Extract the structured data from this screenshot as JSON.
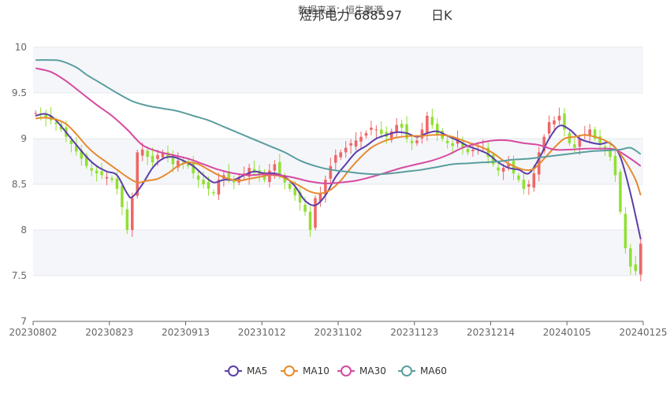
{
  "chart_data": {
    "type": "candlestick",
    "title": "煜邦电力 688597",
    "title_suffix": "日K",
    "subtitle": "数据来源：恒生聚源",
    "xlabel": "",
    "ylabel": "",
    "ylim": [
      7,
      10
    ],
    "yticks": [
      7,
      7.5,
      8,
      8.5,
      9,
      9.5,
      10
    ],
    "ytick_labels": [
      "7",
      "7.5",
      "8",
      "8.5",
      "9",
      "9.5",
      "10"
    ],
    "xtick_labels": [
      "20230802",
      "20230823",
      "20230913",
      "20231012",
      "20231102",
      "20231123",
      "20231214",
      "20240105",
      "20240125"
    ],
    "n_days": 120,
    "up_color": "#ee6666",
    "down_color": "#91e033",
    "grid_band_color": "#f5f6fa",
    "close": [
      9.28,
      9.26,
      9.22,
      9.2,
      9.16,
      9.1,
      9.02,
      8.94,
      8.86,
      8.78,
      8.7,
      8.65,
      8.62,
      8.6,
      8.58,
      8.55,
      8.45,
      8.25,
      8.0,
      8.35,
      8.85,
      8.88,
      8.8,
      8.74,
      8.82,
      8.85,
      8.8,
      8.72,
      8.76,
      8.74,
      8.7,
      8.62,
      8.55,
      8.5,
      8.45,
      8.4,
      8.55,
      8.6,
      8.56,
      8.52,
      8.58,
      8.62,
      8.68,
      8.64,
      8.6,
      8.55,
      8.65,
      8.72,
      8.6,
      8.52,
      8.45,
      8.38,
      8.3,
      8.2,
      8.0,
      8.35,
      8.4,
      8.55,
      8.7,
      8.82,
      8.85,
      8.9,
      8.95,
      8.98,
      9.02,
      9.06,
      9.12,
      9.1,
      9.05,
      9.02,
      9.08,
      9.15,
      9.12,
      9.0,
      8.95,
      8.98,
      9.1,
      9.25,
      9.15,
      9.05,
      9.0,
      8.95,
      8.92,
      9.0,
      8.9,
      8.85,
      8.88,
      8.92,
      8.9,
      8.8,
      8.72,
      8.65,
      8.68,
      8.72,
      8.62,
      8.55,
      8.45,
      8.5,
      8.62,
      8.85,
      9.02,
      9.18,
      9.2,
      9.25,
      9.1,
      8.95,
      8.9,
      9.0,
      9.05,
      9.1,
      9.0,
      8.95,
      8.9,
      8.8,
      8.6,
      8.2,
      7.8,
      7.6,
      7.55,
      7.85
    ],
    "series": [
      {
        "name": "MA5",
        "color": "#5b3ea8",
        "points": [
          [
            0,
            9.25
          ],
          [
            2,
            9.27
          ],
          [
            4,
            9.2
          ],
          [
            7,
            9.0
          ],
          [
            10,
            8.8
          ],
          [
            12,
            8.7
          ],
          [
            14,
            8.64
          ],
          [
            16,
            8.6
          ],
          [
            18,
            8.4
          ],
          [
            19,
            8.36
          ],
          [
            21,
            8.5
          ],
          [
            23,
            8.68
          ],
          [
            25,
            8.78
          ],
          [
            27,
            8.8
          ],
          [
            29,
            8.76
          ],
          [
            31,
            8.7
          ],
          [
            33,
            8.6
          ],
          [
            35,
            8.52
          ],
          [
            37,
            8.55
          ],
          [
            39,
            8.55
          ],
          [
            41,
            8.6
          ],
          [
            43,
            8.64
          ],
          [
            45,
            8.62
          ],
          [
            47,
            8.62
          ],
          [
            49,
            8.58
          ],
          [
            51,
            8.48
          ],
          [
            53,
            8.32
          ],
          [
            55,
            8.27
          ],
          [
            57,
            8.38
          ],
          [
            59,
            8.58
          ],
          [
            61,
            8.72
          ],
          [
            63,
            8.85
          ],
          [
            65,
            8.92
          ],
          [
            67,
            9.0
          ],
          [
            69,
            9.04
          ],
          [
            71,
            9.07
          ],
          [
            73,
            9.06
          ],
          [
            75,
            9.02
          ],
          [
            77,
            9.06
          ],
          [
            79,
            9.08
          ],
          [
            81,
            9.03
          ],
          [
            83,
            8.98
          ],
          [
            85,
            8.92
          ],
          [
            87,
            8.88
          ],
          [
            89,
            8.83
          ],
          [
            91,
            8.74
          ],
          [
            93,
            8.68
          ],
          [
            95,
            8.66
          ],
          [
            97,
            8.62
          ],
          [
            99,
            8.78
          ],
          [
            101,
            9.0
          ],
          [
            103,
            9.14
          ],
          [
            105,
            9.1
          ],
          [
            107,
            9.0
          ],
          [
            109,
            8.96
          ],
          [
            111,
            8.94
          ],
          [
            113,
            8.95
          ],
          [
            115,
            8.8
          ],
          [
            117,
            8.4
          ],
          [
            119,
            7.9
          ]
        ]
      },
      {
        "name": "MA10",
        "color": "#e68a2e",
        "points": [
          [
            0,
            9.22
          ],
          [
            2,
            9.23
          ],
          [
            4,
            9.21
          ],
          [
            6,
            9.16
          ],
          [
            8,
            9.05
          ],
          [
            10,
            8.92
          ],
          [
            12,
            8.82
          ],
          [
            14,
            8.74
          ],
          [
            16,
            8.66
          ],
          [
            18,
            8.58
          ],
          [
            20,
            8.52
          ],
          [
            22,
            8.54
          ],
          [
            24,
            8.56
          ],
          [
            26,
            8.62
          ],
          [
            28,
            8.7
          ],
          [
            30,
            8.74
          ],
          [
            32,
            8.72
          ],
          [
            34,
            8.66
          ],
          [
            36,
            8.6
          ],
          [
            38,
            8.56
          ],
          [
            40,
            8.54
          ],
          [
            42,
            8.56
          ],
          [
            44,
            8.58
          ],
          [
            46,
            8.6
          ],
          [
            48,
            8.59
          ],
          [
            50,
            8.54
          ],
          [
            52,
            8.48
          ],
          [
            54,
            8.42
          ],
          [
            56,
            8.4
          ],
          [
            58,
            8.44
          ],
          [
            60,
            8.54
          ],
          [
            62,
            8.68
          ],
          [
            64,
            8.8
          ],
          [
            66,
            8.9
          ],
          [
            68,
            8.96
          ],
          [
            70,
            9.0
          ],
          [
            72,
            9.02
          ],
          [
            74,
            9.03
          ],
          [
            76,
            9.03
          ],
          [
            78,
            9.04
          ],
          [
            80,
            9.04
          ],
          [
            82,
            9.02
          ],
          [
            84,
            8.98
          ],
          [
            86,
            8.94
          ],
          [
            88,
            8.9
          ],
          [
            90,
            8.84
          ],
          [
            92,
            8.76
          ],
          [
            94,
            8.7
          ],
          [
            96,
            8.66
          ],
          [
            98,
            8.67
          ],
          [
            100,
            8.78
          ],
          [
            102,
            8.9
          ],
          [
            104,
            9.0
          ],
          [
            106,
            9.02
          ],
          [
            108,
            9.04
          ],
          [
            110,
            9.02
          ],
          [
            112,
            8.98
          ],
          [
            114,
            8.9
          ],
          [
            116,
            8.75
          ],
          [
            118,
            8.55
          ],
          [
            119,
            8.38
          ]
        ]
      },
      {
        "name": "MA30",
        "color": "#d64a9f",
        "points": [
          [
            0,
            9.77
          ],
          [
            3,
            9.73
          ],
          [
            6,
            9.63
          ],
          [
            9,
            9.5
          ],
          [
            12,
            9.37
          ],
          [
            15,
            9.25
          ],
          [
            18,
            9.1
          ],
          [
            21,
            8.93
          ],
          [
            24,
            8.86
          ],
          [
            27,
            8.82
          ],
          [
            30,
            8.78
          ],
          [
            33,
            8.72
          ],
          [
            36,
            8.66
          ],
          [
            39,
            8.62
          ],
          [
            42,
            8.6
          ],
          [
            45,
            8.61
          ],
          [
            48,
            8.6
          ],
          [
            51,
            8.57
          ],
          [
            54,
            8.53
          ],
          [
            57,
            8.51
          ],
          [
            60,
            8.52
          ],
          [
            63,
            8.54
          ],
          [
            66,
            8.58
          ],
          [
            69,
            8.63
          ],
          [
            72,
            8.68
          ],
          [
            75,
            8.72
          ],
          [
            78,
            8.76
          ],
          [
            81,
            8.82
          ],
          [
            84,
            8.9
          ],
          [
            87,
            8.95
          ],
          [
            90,
            8.98
          ],
          [
            93,
            8.98
          ],
          [
            96,
            8.95
          ],
          [
            99,
            8.93
          ],
          [
            102,
            8.88
          ],
          [
            105,
            8.88
          ],
          [
            108,
            8.89
          ],
          [
            111,
            8.89
          ],
          [
            114,
            8.88
          ],
          [
            117,
            8.78
          ],
          [
            119,
            8.7
          ]
        ]
      },
      {
        "name": "MA60",
        "color": "#5a9e9e",
        "points": [
          [
            0,
            9.86
          ],
          [
            3,
            9.86
          ],
          [
            5,
            9.85
          ],
          [
            8,
            9.78
          ],
          [
            10,
            9.7
          ],
          [
            13,
            9.6
          ],
          [
            16,
            9.5
          ],
          [
            19,
            9.41
          ],
          [
            22,
            9.36
          ],
          [
            25,
            9.33
          ],
          [
            28,
            9.3
          ],
          [
            31,
            9.25
          ],
          [
            34,
            9.2
          ],
          [
            37,
            9.13
          ],
          [
            40,
            9.06
          ],
          [
            43,
            8.99
          ],
          [
            46,
            8.92
          ],
          [
            49,
            8.85
          ],
          [
            52,
            8.76
          ],
          [
            55,
            8.7
          ],
          [
            58,
            8.66
          ],
          [
            61,
            8.64
          ],
          [
            64,
            8.62
          ],
          [
            67,
            8.61
          ],
          [
            70,
            8.62
          ],
          [
            73,
            8.64
          ],
          [
            76,
            8.66
          ],
          [
            79,
            8.69
          ],
          [
            82,
            8.72
          ],
          [
            85,
            8.73
          ],
          [
            88,
            8.74
          ],
          [
            91,
            8.75
          ],
          [
            94,
            8.77
          ],
          [
            97,
            8.78
          ],
          [
            100,
            8.8
          ],
          [
            103,
            8.82
          ],
          [
            106,
            8.84
          ],
          [
            109,
            8.86
          ],
          [
            112,
            8.87
          ],
          [
            115,
            8.88
          ],
          [
            117,
            8.9
          ],
          [
            119,
            8.83
          ]
        ]
      }
    ]
  }
}
